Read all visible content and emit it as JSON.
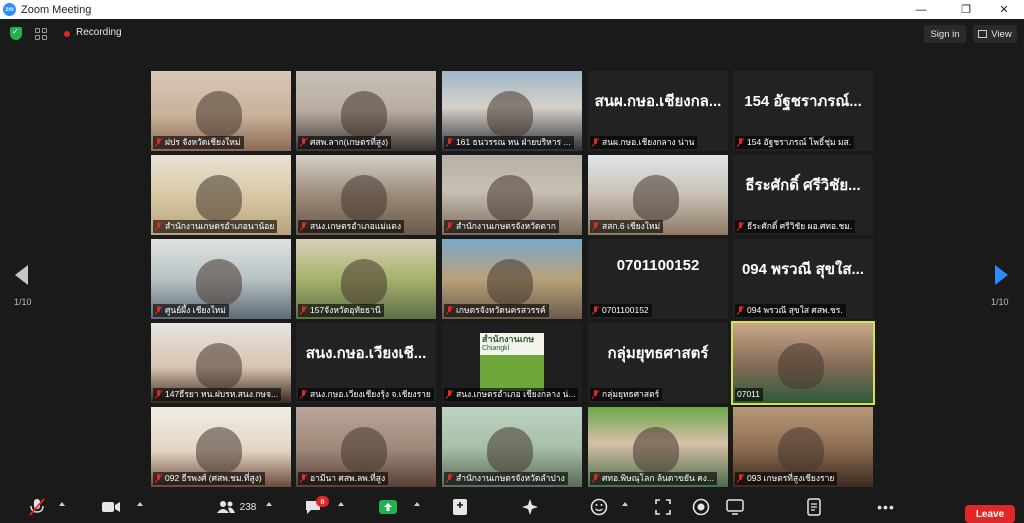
{
  "window": {
    "title": "Zoom Meeting",
    "logo": "zm"
  },
  "topbar": {
    "recording_label": "Recording",
    "signin_label": "Sign in",
    "view_label": "View"
  },
  "pagination": {
    "left": "1/10",
    "right": "1/10"
  },
  "tiles": [
    {
      "name": "ฝปร จังหวัดเชียงใหม่",
      "big": "",
      "active": false
    },
    {
      "name": "ศสพ.ลาก(เกษตรที่สูง)",
      "big": "",
      "active": false
    },
    {
      "name": "161 ธนวรรณ หน ฝ่ายบริหาร ...",
      "big": "",
      "active": false
    },
    {
      "name": "สนผ.กษอ.เชียงกลาง น่าน",
      "big": "สนผ.กษอ.เชียงกล...",
      "active": false
    },
    {
      "name": "154 อัฐชราภรณ์ โพธิ์ชุ่ม มส.",
      "big": "154 อัฐชราภรณ์...",
      "active": false
    },
    {
      "name": "สำนักงานเกษตรอำเภอนาน้อย",
      "big": "",
      "active": false
    },
    {
      "name": "สนง.เกษตรอำเภอแม่แตง",
      "big": "",
      "active": false
    },
    {
      "name": "สำนักงานเกษตรจังหวัดตาก",
      "big": "",
      "active": false
    },
    {
      "name": "สสก.6 เชียงใหม่",
      "big": "",
      "active": false
    },
    {
      "name": "ธีระศักดิ์ ศรีวิชัย ผอ.ศทอ.ชม.",
      "big": "ธีระศักดิ์ ศรีวิชัย...",
      "active": false
    },
    {
      "name": "ศูนย์ผึ้ง เชียงใหม่",
      "big": "",
      "active": false
    },
    {
      "name": "157จังหวัดอุทัยธานี",
      "big": "",
      "active": false
    },
    {
      "name": "เกษตรจังหวัดนครสวรรค์",
      "big": "",
      "active": false
    },
    {
      "name": "0701100152",
      "big": "0701100152",
      "active": false
    },
    {
      "name": "094 พรวณี สุขใส ศสพ.ชร.",
      "big": "094 พรวณี สุขใส...",
      "active": false
    },
    {
      "name": "147ธีรยา หน.ฝบรห.สนง.กษจ...",
      "big": "",
      "active": false
    },
    {
      "name": "สนง.กษอ.เวียงเชียงรุ้ง จ.เชียงราย",
      "big": "สนง.กษอ.เวียงเชี...",
      "active": false
    },
    {
      "name": "สนง.เกษตรอำเภอ เชียงกลาง น่...",
      "big": "",
      "active": false
    },
    {
      "name": "กลุ่มยุทธศาสตร์",
      "big": "กลุ่มยุทธศาสตร์",
      "active": false
    },
    {
      "name": "07011",
      "big": "",
      "active": true
    },
    {
      "name": "092 ธีรพงศ์ (ศสพ.ชม.ที่สูง)",
      "big": "",
      "active": false
    },
    {
      "name": "อามีนา ศสพ.ลพ.ที่สูง",
      "big": "",
      "active": false
    },
    {
      "name": "สำนักงานเกษตรจังหวัดลำปาง",
      "big": "",
      "active": false
    },
    {
      "name": "ศทอ.พิษณุโลก ล้นดาขยัน คง...",
      "big": "",
      "active": false
    },
    {
      "name": "093 เกษตรที่สูงเชียงราย",
      "big": "",
      "active": false
    }
  ],
  "tile_banner": {
    "text": "สำนักงานเกษ",
    "subtext": "Chiangkl"
  },
  "toolbar": {
    "participants_count": "238",
    "chat_badge": "8",
    "leave_label": "Leave"
  },
  "colors": {
    "accent": "#2d8cff",
    "recording": "#e02828",
    "active_speaker": "#d4e34a",
    "leave": "#e02828"
  }
}
